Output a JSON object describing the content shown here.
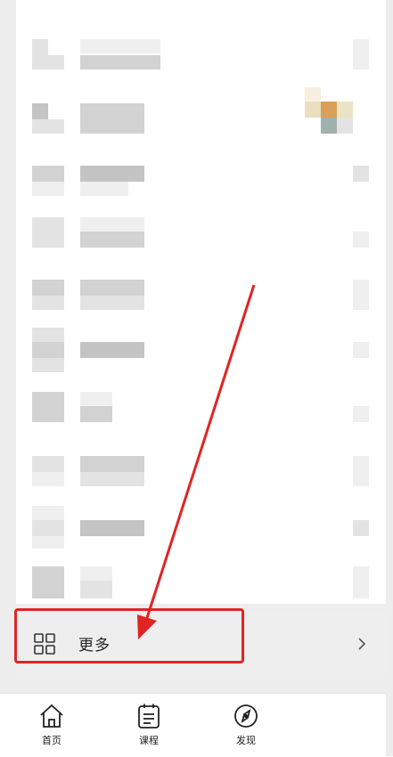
{
  "more_entry": {
    "label": "更多",
    "grid_icon": "grid-icon",
    "chevron_icon": "chevron-right-icon"
  },
  "tabbar": {
    "items": [
      {
        "label": "首页",
        "icon": "home-icon"
      },
      {
        "label": "课程",
        "icon": "course-icon"
      },
      {
        "label": "发现",
        "icon": "discover-icon"
      }
    ]
  },
  "annotation": {
    "box_color": "#e02424",
    "arrow_color": "#e02424"
  }
}
